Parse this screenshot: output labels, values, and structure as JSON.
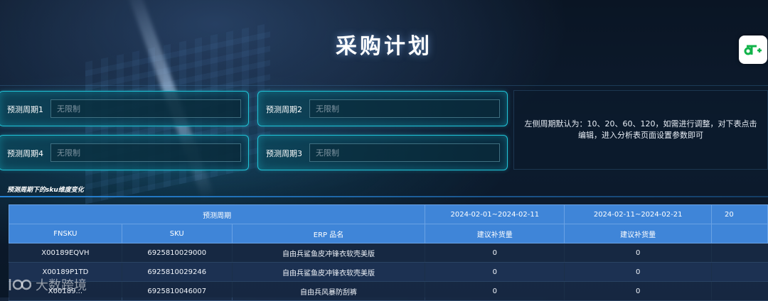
{
  "page_title": "采购计划",
  "fields": [
    {
      "label": "预测周期1",
      "placeholder": "无限制"
    },
    {
      "label": "预测周期2",
      "placeholder": "无限制"
    },
    {
      "label": "预测周期4",
      "placeholder": "无限制"
    },
    {
      "label": "预测周期3",
      "placeholder": "无限制"
    }
  ],
  "side_note": "左侧周期默认为：10、20、60、120，如需进行调整，对下表点击编辑，进入分析表页面设置参数即可",
  "section_title": "预测周期下的sku维度变化",
  "table": {
    "group_header": "预测周期",
    "periods": [
      "2024-02-01~2024-02-11",
      "2024-02-11~2024-02-21",
      "20"
    ],
    "columns": [
      "FNSKU",
      "SKU",
      "ERP 品名"
    ],
    "period_subheader": "建议补货量",
    "rows": [
      {
        "fnsku": "X00189EQVH",
        "sku": "6925810029000",
        "name": "自由兵鲨鱼皮冲锋衣软壳美版",
        "v1": "0",
        "v2": "0"
      },
      {
        "fnsku": "X00189P1TD",
        "sku": "6925810029246",
        "name": "自由兵鲨鱼皮冲锋衣软壳美版",
        "v1": "0",
        "v2": "0"
      },
      {
        "fnsku": "X00189...",
        "sku": "6925810046007",
        "name": "自由兵风暴防刮裤",
        "v1": "0",
        "v2": "0"
      }
    ]
  },
  "watermark": "大数跨境",
  "colors": {
    "accent": "#20c4d8",
    "header_blue": "#3f85d8"
  },
  "icons": {
    "app_button": "fork-plus-icon"
  }
}
